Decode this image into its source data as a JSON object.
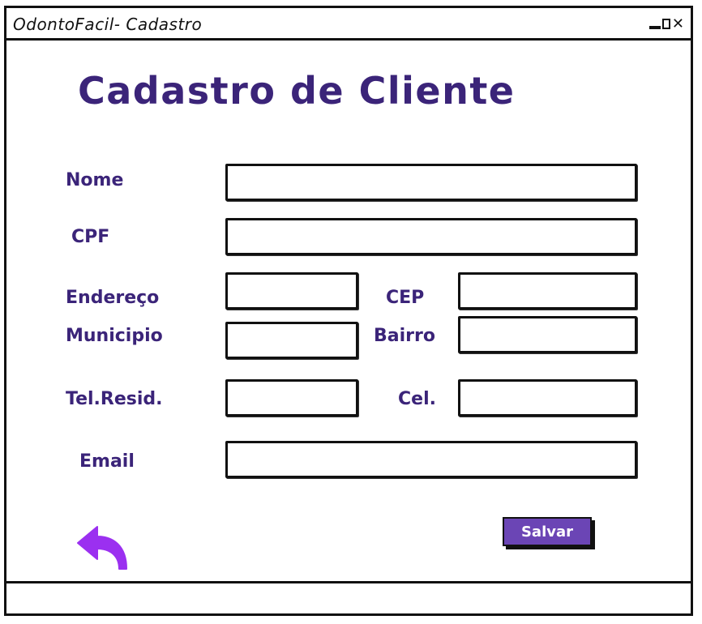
{
  "window": {
    "title": "OdontoFacil- Cadastro"
  },
  "form": {
    "heading": "Cadastro de Cliente",
    "fields": {
      "nome": {
        "label": "Nome",
        "value": ""
      },
      "cpf": {
        "label": "CPF",
        "value": ""
      },
      "endereco": {
        "label": "Endereço",
        "value": ""
      },
      "cep": {
        "label": "CEP",
        "value": ""
      },
      "municipio": {
        "label": "Municipio",
        "value": ""
      },
      "bairro": {
        "label": "Bairro",
        "value": ""
      },
      "tel_resid": {
        "label": "Tel.Resid.",
        "value": ""
      },
      "cel": {
        "label": "Cel.",
        "value": ""
      },
      "email": {
        "label": "Email",
        "value": ""
      }
    },
    "save_label": "Salvar"
  },
  "icons": {
    "back": "back-arrow-icon",
    "minimize": "minimize-icon",
    "maximize": "maximize-icon",
    "close": "close-icon"
  },
  "colors": {
    "label": "#3b2479",
    "accent": "#6b45b5",
    "back_icon": "#9b30f0"
  }
}
